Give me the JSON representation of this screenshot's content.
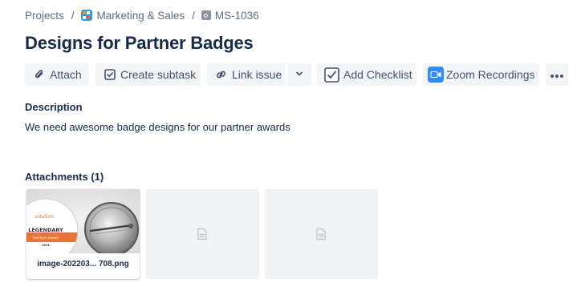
{
  "breadcrumb": {
    "projects": "Projects",
    "separator": "/",
    "project_name": "Marketing & Sales",
    "issue_key": "MS-1036"
  },
  "issue": {
    "title": "Designs for Partner Badges"
  },
  "toolbar": {
    "attach": "Attach",
    "create_subtask": "Create subtask",
    "link_issue": "Link issue",
    "add_checklist": "Add Checklist",
    "zoom_recordings": "Zoom Recordings"
  },
  "description": {
    "heading": "Description",
    "text": "We need awesome badge designs for our partner awards"
  },
  "attachments": {
    "heading": "Attachments (1)",
    "items": [
      {
        "filename": "image-202203... 708.png",
        "badge_text_top": "solution",
        "badge_text_main": "LEGENDARY",
        "badge_text_band": "PARTNER AWARD",
        "badge_text_year": "2021"
      }
    ]
  },
  "colors": {
    "accent": "#0052cc",
    "button_bg": "#f4f5f7",
    "text_primary": "#172b4d",
    "text_secondary": "#5e6c84",
    "zoom_blue": "#2d8cff",
    "badge_orange": "#e8743b"
  }
}
